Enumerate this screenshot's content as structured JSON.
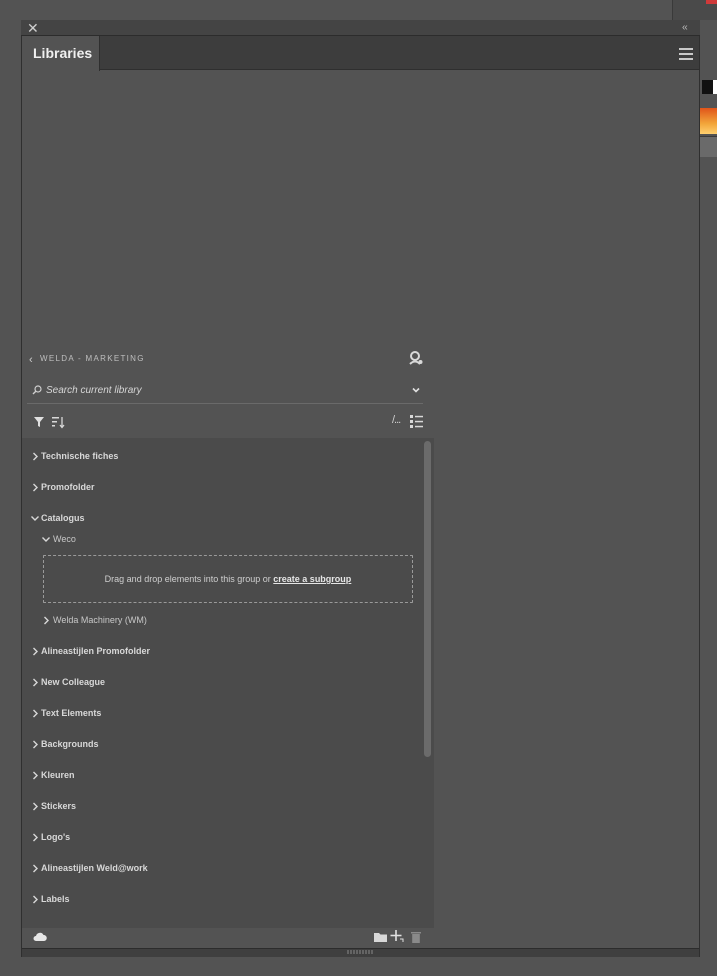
{
  "panel": {
    "tab_label": "Libraries"
  },
  "library": {
    "name": "WELDA - MARKETING",
    "search_placeholder": "Search current library",
    "text_view_label": "/...",
    "groups": [
      {
        "label": "Technische fiches",
        "expanded": false
      },
      {
        "label": "Promofolder",
        "expanded": false
      },
      {
        "label": "Catalogus",
        "expanded": true
      },
      {
        "label": "Alineastijlen Promofolder",
        "expanded": false
      },
      {
        "label": "New Colleague",
        "expanded": false
      },
      {
        "label": "Text Elements",
        "expanded": false
      },
      {
        "label": "Backgrounds",
        "expanded": false
      },
      {
        "label": "Kleuren",
        "expanded": false
      },
      {
        "label": "Stickers",
        "expanded": false
      },
      {
        "label": "Logo's",
        "expanded": false
      },
      {
        "label": "Alineastijlen Weld@work",
        "expanded": false
      },
      {
        "label": "Labels",
        "expanded": false
      }
    ],
    "subgroups": [
      {
        "label": "Weco",
        "expanded": true
      },
      {
        "label": "Welda Machinery (WM)",
        "expanded": false
      }
    ],
    "drop_zone": {
      "text": "Drag and drop elements into this group or ",
      "link": "create a subgroup"
    }
  },
  "colors": {
    "panel_bg": "#535353",
    "list_bg": "#4b4b4b",
    "tab_bar_bg": "#3d3d3d"
  }
}
